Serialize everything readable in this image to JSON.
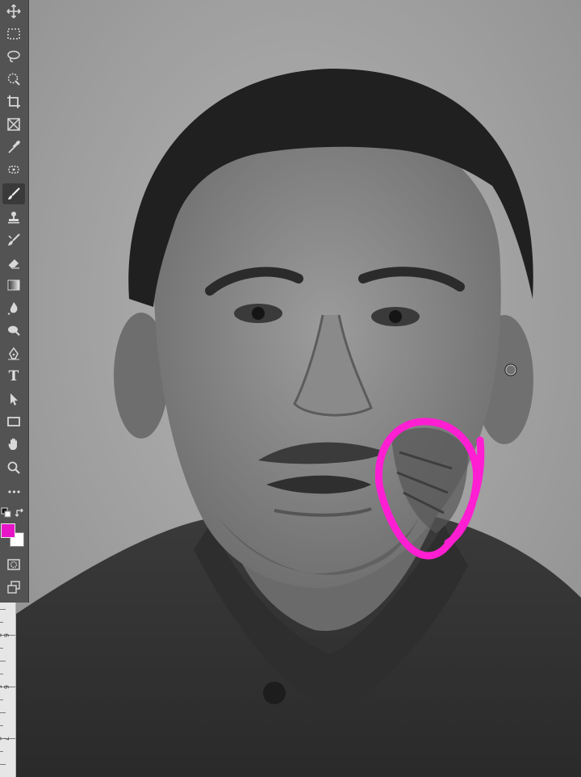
{
  "app": {
    "name": "image-editor"
  },
  "toolbar": {
    "tools": [
      {
        "icon": "move-icon"
      },
      {
        "icon": "rectangular-marquee-icon"
      },
      {
        "icon": "lasso-icon"
      },
      {
        "icon": "quick-selection-icon"
      },
      {
        "icon": "crop-icon"
      },
      {
        "icon": "frame-icon"
      },
      {
        "icon": "eyedropper-icon"
      },
      {
        "icon": "spot-healing-icon"
      },
      {
        "icon": "brush-icon",
        "active": true
      },
      {
        "icon": "clone-stamp-icon"
      },
      {
        "icon": "history-brush-icon"
      },
      {
        "icon": "eraser-icon"
      },
      {
        "icon": "gradient-icon"
      },
      {
        "icon": "blur-icon"
      },
      {
        "icon": "dodge-icon"
      },
      {
        "icon": "pen-icon"
      },
      {
        "icon": "type-icon",
        "label": "T"
      },
      {
        "icon": "path-selection-icon"
      },
      {
        "icon": "rectangle-shape-icon"
      },
      {
        "icon": "hand-icon"
      },
      {
        "icon": "zoom-icon"
      },
      {
        "icon": "more-tools-icon",
        "label": "•••"
      }
    ],
    "foreground_color": "#e815c8",
    "background_color": "#ffffff"
  },
  "ruler": {
    "labels": [
      "6 0",
      "6 5",
      "7 0"
    ]
  },
  "colors": {
    "annotation": "#ff1ed2",
    "toolbar_bg": "#535353",
    "canvas_bg": "#9a9a9a"
  }
}
